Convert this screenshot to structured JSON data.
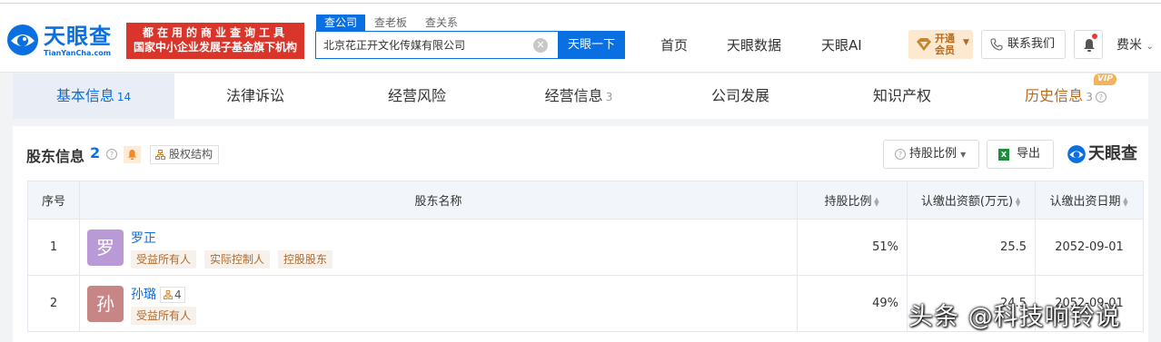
{
  "header": {
    "logo_text": "天眼查",
    "logo_sub": "TianYanCha.com",
    "ad_line1": "都在用的商业查询工具",
    "ad_line2": "国家中小企业发展子基金旗下机构",
    "search_tabs": [
      "查公司",
      "查老板",
      "查关系"
    ],
    "search_value": "北京花正开文化传媒有限公司",
    "search_button": "天眼一下",
    "nav": [
      "首页",
      "天眼数据",
      "天眼AI"
    ],
    "vip_line1": "开通",
    "vip_line2": "会员",
    "contact": "联系我们",
    "user": "费米"
  },
  "tabs": [
    {
      "label": "基本信息",
      "count": "14"
    },
    {
      "label": "法律诉讼",
      "count": ""
    },
    {
      "label": "经营风险",
      "count": ""
    },
    {
      "label": "经营信息",
      "count": "3"
    },
    {
      "label": "公司发展",
      "count": ""
    },
    {
      "label": "知识产权",
      "count": ""
    },
    {
      "label": "历史信息",
      "count": "3",
      "badge": "VIP"
    }
  ],
  "section": {
    "title": "股东信息",
    "count": "2",
    "structure_button": "股权结构",
    "ratio_button": "持股比例",
    "export_button": "导出",
    "brand": "天眼查"
  },
  "table": {
    "headers": [
      "序号",
      "股东名称",
      "持股比例",
      "认缴出资额(万元)",
      "认缴出资日期"
    ],
    "rows": [
      {
        "index": "1",
        "avatar": "罗",
        "name": "罗正",
        "tags": [
          "受益所有人",
          "实际控制人",
          "控股股东"
        ],
        "links": "",
        "ratio": "51%",
        "amount": "25.5",
        "date": "2052-09-01"
      },
      {
        "index": "2",
        "avatar": "孙",
        "name": "孙璐",
        "tags": [
          "受益所有人"
        ],
        "links": "4",
        "ratio": "49%",
        "amount": "24.5",
        "date": "2052-09-01"
      }
    ]
  },
  "watermark": "头条 @科技响铃说",
  "colors": {
    "brand_blue": "#0a6fe0",
    "ad_red": "#d9352a",
    "tag_brown": "#b26a2e",
    "avatar1": "#b99ad6",
    "avatar2": "#c88585"
  }
}
